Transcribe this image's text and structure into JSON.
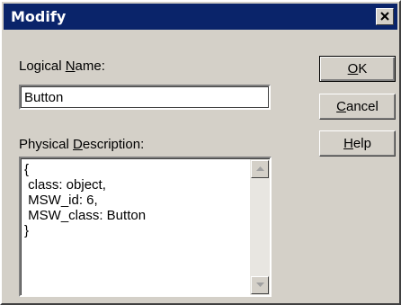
{
  "window": {
    "title": "Modify",
    "close_icon": "close-icon"
  },
  "logical_name": {
    "label_prefix": "Logical ",
    "label_mnemonic": "N",
    "label_suffix": "ame:",
    "value": "Button"
  },
  "physical_description": {
    "label_prefix": "Physical ",
    "label_mnemonic": "D",
    "label_suffix": "escription:",
    "text": "{\n class: object,\n MSW_id: 6,\n MSW_class: Button\n}"
  },
  "buttons": {
    "ok": {
      "mnemonic": "O",
      "rest": "K"
    },
    "cancel": {
      "mnemonic": "C",
      "rest": "ancel"
    },
    "help": {
      "mnemonic": "H",
      "rest": "elp"
    }
  },
  "colors": {
    "titlebar": "#0a246a",
    "face": "#d4d0c8"
  }
}
